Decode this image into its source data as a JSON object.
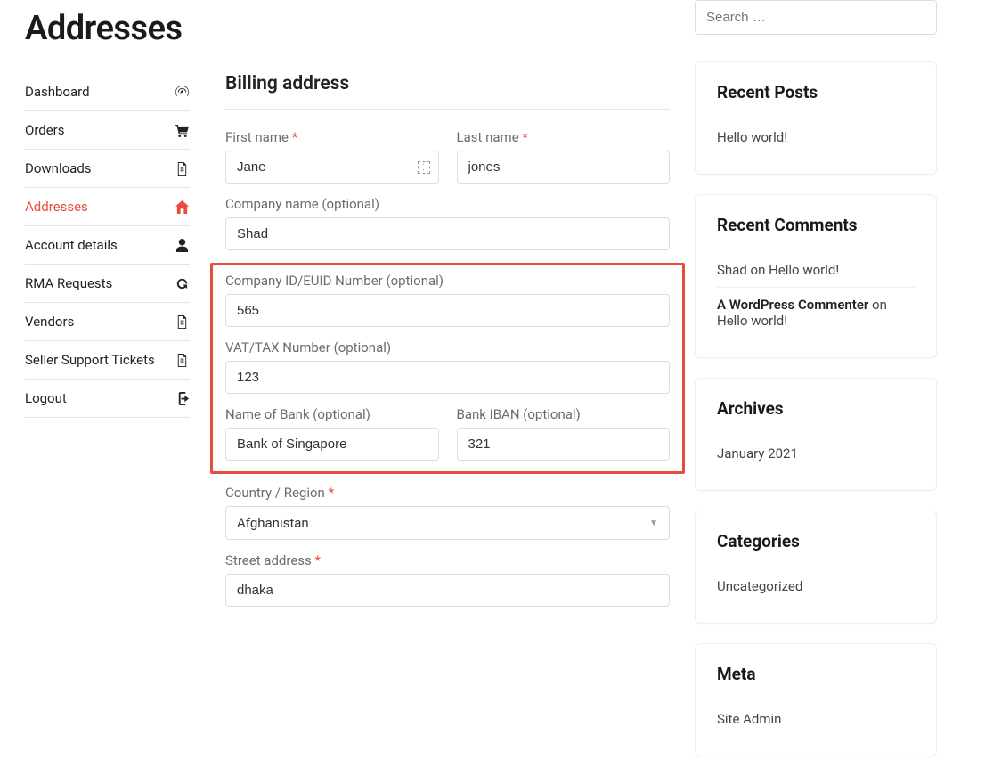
{
  "page": {
    "title": "Addresses"
  },
  "nav": {
    "items": [
      {
        "label": "Dashboard",
        "icon": "dashboard",
        "active": false
      },
      {
        "label": "Orders",
        "icon": "cart",
        "active": false
      },
      {
        "label": "Downloads",
        "icon": "document",
        "active": false
      },
      {
        "label": "Addresses",
        "icon": "home",
        "active": true
      },
      {
        "label": "Account details",
        "icon": "user",
        "active": false
      },
      {
        "label": "RMA Requests",
        "icon": "refresh",
        "active": false
      },
      {
        "label": "Vendors",
        "icon": "document",
        "active": false
      },
      {
        "label": "Seller Support Tickets",
        "icon": "document",
        "active": false
      },
      {
        "label": "Logout",
        "icon": "logout",
        "active": false
      }
    ]
  },
  "form": {
    "section_title": "Billing address",
    "first_name": {
      "label": "First name",
      "value": "Jane",
      "required": true
    },
    "last_name": {
      "label": "Last name",
      "value": "jones",
      "required": true
    },
    "company_name": {
      "label": "Company name (optional)",
      "value": "Shad"
    },
    "company_id": {
      "label": "Company ID/EUID Number (optional)",
      "value": "565"
    },
    "vat_number": {
      "label": "VAT/TAX Number (optional)",
      "value": "123"
    },
    "bank_name": {
      "label": "Name of Bank (optional)",
      "value": "Bank of Singapore"
    },
    "bank_iban": {
      "label": "Bank IBAN (optional)",
      "value": "321"
    },
    "country": {
      "label": "Country / Region",
      "value": "Afghanistan",
      "required": true
    },
    "street": {
      "label": "Street address",
      "value": "dhaka",
      "required": true
    },
    "required_marker": "*"
  },
  "sidebar": {
    "search": {
      "placeholder": "Search …"
    },
    "widgets": {
      "recent_posts": {
        "title": "Recent Posts",
        "items": [
          "Hello world!"
        ]
      },
      "recent_comments": {
        "title": "Recent Comments",
        "items": [
          {
            "author": "Shad",
            "on": "on",
            "post": "Hello world!"
          },
          {
            "author": "A WordPress Commenter",
            "on": "on",
            "post": "Hello world!"
          }
        ]
      },
      "archives": {
        "title": "Archives",
        "items": [
          "January 2021"
        ]
      },
      "categories": {
        "title": "Categories",
        "items": [
          "Uncategorized"
        ]
      },
      "meta": {
        "title": "Meta",
        "items": [
          "Site Admin"
        ]
      }
    }
  }
}
